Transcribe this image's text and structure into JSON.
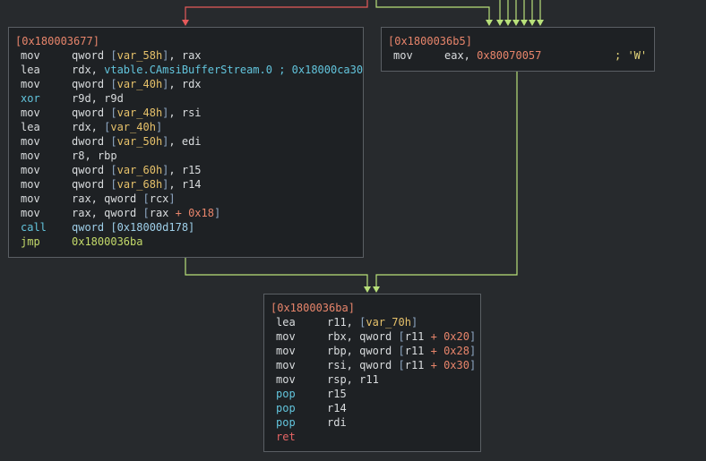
{
  "colors": {
    "background": "#272a2d",
    "block_bg": "#1e2124",
    "block_border": "#5a5f64",
    "edge_false": "#e55a5a",
    "edge_true": "#b8e07a",
    "address": "#e8856b"
  },
  "blocks": [
    {
      "addr": "[0x180003677]",
      "lines": [
        {
          "m": "mov",
          "mk": "def",
          "ops": [
            [
              "r",
              "qword "
            ],
            [
              "b",
              "["
            ],
            [
              "v",
              "var_58h"
            ],
            [
              "b",
              "]"
            ],
            [
              "r",
              ", rax"
            ]
          ]
        },
        {
          "m": "lea",
          "mk": "def",
          "ops": [
            [
              "r",
              "rdx, "
            ],
            [
              "s",
              "vtable.CAmsiBufferStream.0 ; 0x18000ca30"
            ]
          ]
        },
        {
          "m": "mov",
          "mk": "def",
          "ops": [
            [
              "r",
              "qword "
            ],
            [
              "b",
              "["
            ],
            [
              "v",
              "var_40h"
            ],
            [
              "b",
              "]"
            ],
            [
              "r",
              ", rdx"
            ]
          ]
        },
        {
          "m": "xor",
          "mk": "call",
          "ops": [
            [
              "r",
              "r9d, r9d"
            ]
          ]
        },
        {
          "m": "mov",
          "mk": "def",
          "ops": [
            [
              "r",
              "qword "
            ],
            [
              "b",
              "["
            ],
            [
              "v",
              "var_48h"
            ],
            [
              "b",
              "]"
            ],
            [
              "r",
              ", rsi"
            ]
          ]
        },
        {
          "m": "lea",
          "mk": "def",
          "ops": [
            [
              "r",
              "rdx, "
            ],
            [
              "b",
              "["
            ],
            [
              "v",
              "var_40h"
            ],
            [
              "b",
              "]"
            ]
          ]
        },
        {
          "m": "mov",
          "mk": "def",
          "ops": [
            [
              "r",
              "dword "
            ],
            [
              "b",
              "["
            ],
            [
              "v",
              "var_50h"
            ],
            [
              "b",
              "]"
            ],
            [
              "r",
              ", edi"
            ]
          ]
        },
        {
          "m": "mov",
          "mk": "def",
          "ops": [
            [
              "r",
              "r8, rbp"
            ]
          ]
        },
        {
          "m": "mov",
          "mk": "def",
          "ops": [
            [
              "r",
              "qword "
            ],
            [
              "b",
              "["
            ],
            [
              "v",
              "var_60h"
            ],
            [
              "b",
              "]"
            ],
            [
              "r",
              ", r15"
            ]
          ]
        },
        {
          "m": "mov",
          "mk": "def",
          "ops": [
            [
              "r",
              "qword "
            ],
            [
              "b",
              "["
            ],
            [
              "v",
              "var_68h"
            ],
            [
              "b",
              "]"
            ],
            [
              "r",
              ", r14"
            ]
          ]
        },
        {
          "m": "mov",
          "mk": "def",
          "ops": [
            [
              "r",
              "rax, qword "
            ],
            [
              "b",
              "["
            ],
            [
              "r",
              "rcx"
            ],
            [
              "b",
              "]"
            ]
          ]
        },
        {
          "m": "mov",
          "mk": "def",
          "ops": [
            [
              "r",
              "rax, qword "
            ],
            [
              "b",
              "["
            ],
            [
              "r",
              "rax "
            ],
            [
              "n",
              "+ 0x18"
            ],
            [
              "b",
              "]"
            ]
          ]
        },
        {
          "m": "call",
          "mk": "call",
          "ops": [
            [
              "d",
              "qword [0x18000d178]"
            ]
          ]
        },
        {
          "m": "jmp",
          "mk": "jmp",
          "ops": [
            [
              "g",
              "0x1800036ba"
            ]
          ]
        }
      ]
    },
    {
      "addr": "[0x1800036b5]",
      "lines": [
        {
          "m": "mov",
          "mk": "def",
          "ops": [
            [
              "r",
              "eax, "
            ],
            [
              "n",
              "0x80070057"
            ]
          ],
          "comment": "; 'W'"
        }
      ]
    },
    {
      "addr": "[0x1800036ba]",
      "lines": [
        {
          "m": "lea",
          "mk": "def",
          "ops": [
            [
              "r",
              "r11, "
            ],
            [
              "b",
              "["
            ],
            [
              "v",
              "var_70h"
            ],
            [
              "b",
              "]"
            ]
          ]
        },
        {
          "m": "mov",
          "mk": "def",
          "ops": [
            [
              "r",
              "rbx, qword "
            ],
            [
              "b",
              "["
            ],
            [
              "r",
              "r11 "
            ],
            [
              "n",
              "+ 0x20"
            ],
            [
              "b",
              "]"
            ]
          ]
        },
        {
          "m": "mov",
          "mk": "def",
          "ops": [
            [
              "r",
              "rbp, qword "
            ],
            [
              "b",
              "["
            ],
            [
              "r",
              "r11 "
            ],
            [
              "n",
              "+ 0x28"
            ],
            [
              "b",
              "]"
            ]
          ]
        },
        {
          "m": "mov",
          "mk": "def",
          "ops": [
            [
              "r",
              "rsi, qword "
            ],
            [
              "b",
              "["
            ],
            [
              "r",
              "r11 "
            ],
            [
              "n",
              "+ 0x30"
            ],
            [
              "b",
              "]"
            ]
          ]
        },
        {
          "m": "mov",
          "mk": "def",
          "ops": [
            [
              "r",
              "rsp, r11"
            ]
          ]
        },
        {
          "m": "pop",
          "mk": "call",
          "ops": [
            [
              "r",
              "r15"
            ]
          ]
        },
        {
          "m": "pop",
          "mk": "call",
          "ops": [
            [
              "r",
              "r14"
            ]
          ]
        },
        {
          "m": "pop",
          "mk": "call",
          "ops": [
            [
              "r",
              "rdi"
            ]
          ]
        },
        {
          "m": "ret",
          "mk": "ret",
          "ops": []
        }
      ]
    }
  ]
}
